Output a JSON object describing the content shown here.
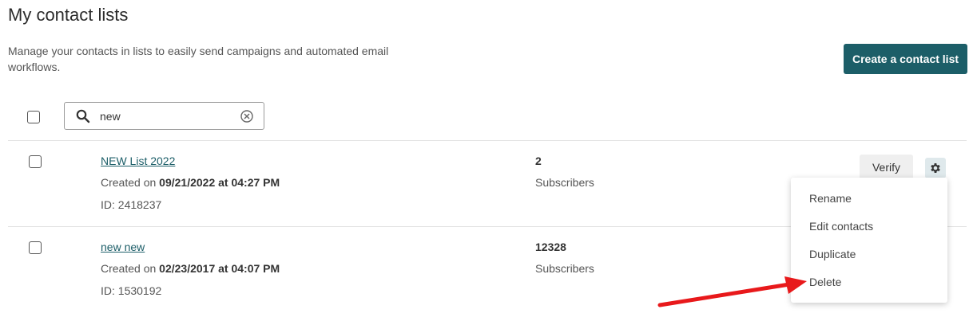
{
  "header": {
    "title": "My contact lists",
    "description": "Manage your contacts in lists to easily send campaigns and automated email workflows.",
    "create_label": "Create a contact list"
  },
  "search": {
    "value": "new",
    "placeholder": ""
  },
  "lists": [
    {
      "name": "NEW List 2022",
      "created_prefix": "Created on",
      "created_date": "09/21/2022 at 04:27 PM",
      "id_text": "ID: 2418237",
      "count": "2",
      "count_label": "Subscribers",
      "verify_label": "Verify"
    },
    {
      "name": "new new",
      "created_prefix": "Created on",
      "created_date": "02/23/2017 at 04:07 PM",
      "id_text": "ID: 1530192",
      "count": "12328",
      "count_label": "Subscribers"
    }
  ],
  "menu": {
    "items": [
      "Rename",
      "Edit contacts",
      "Duplicate",
      "Delete"
    ]
  },
  "colors": {
    "accent": "#1c5e68",
    "annotation_arrow": "#e8191b"
  },
  "icons": {
    "search": "search-icon",
    "clear": "clear-icon",
    "settings": "gear-icon",
    "annotation": "red-arrow-icon"
  }
}
